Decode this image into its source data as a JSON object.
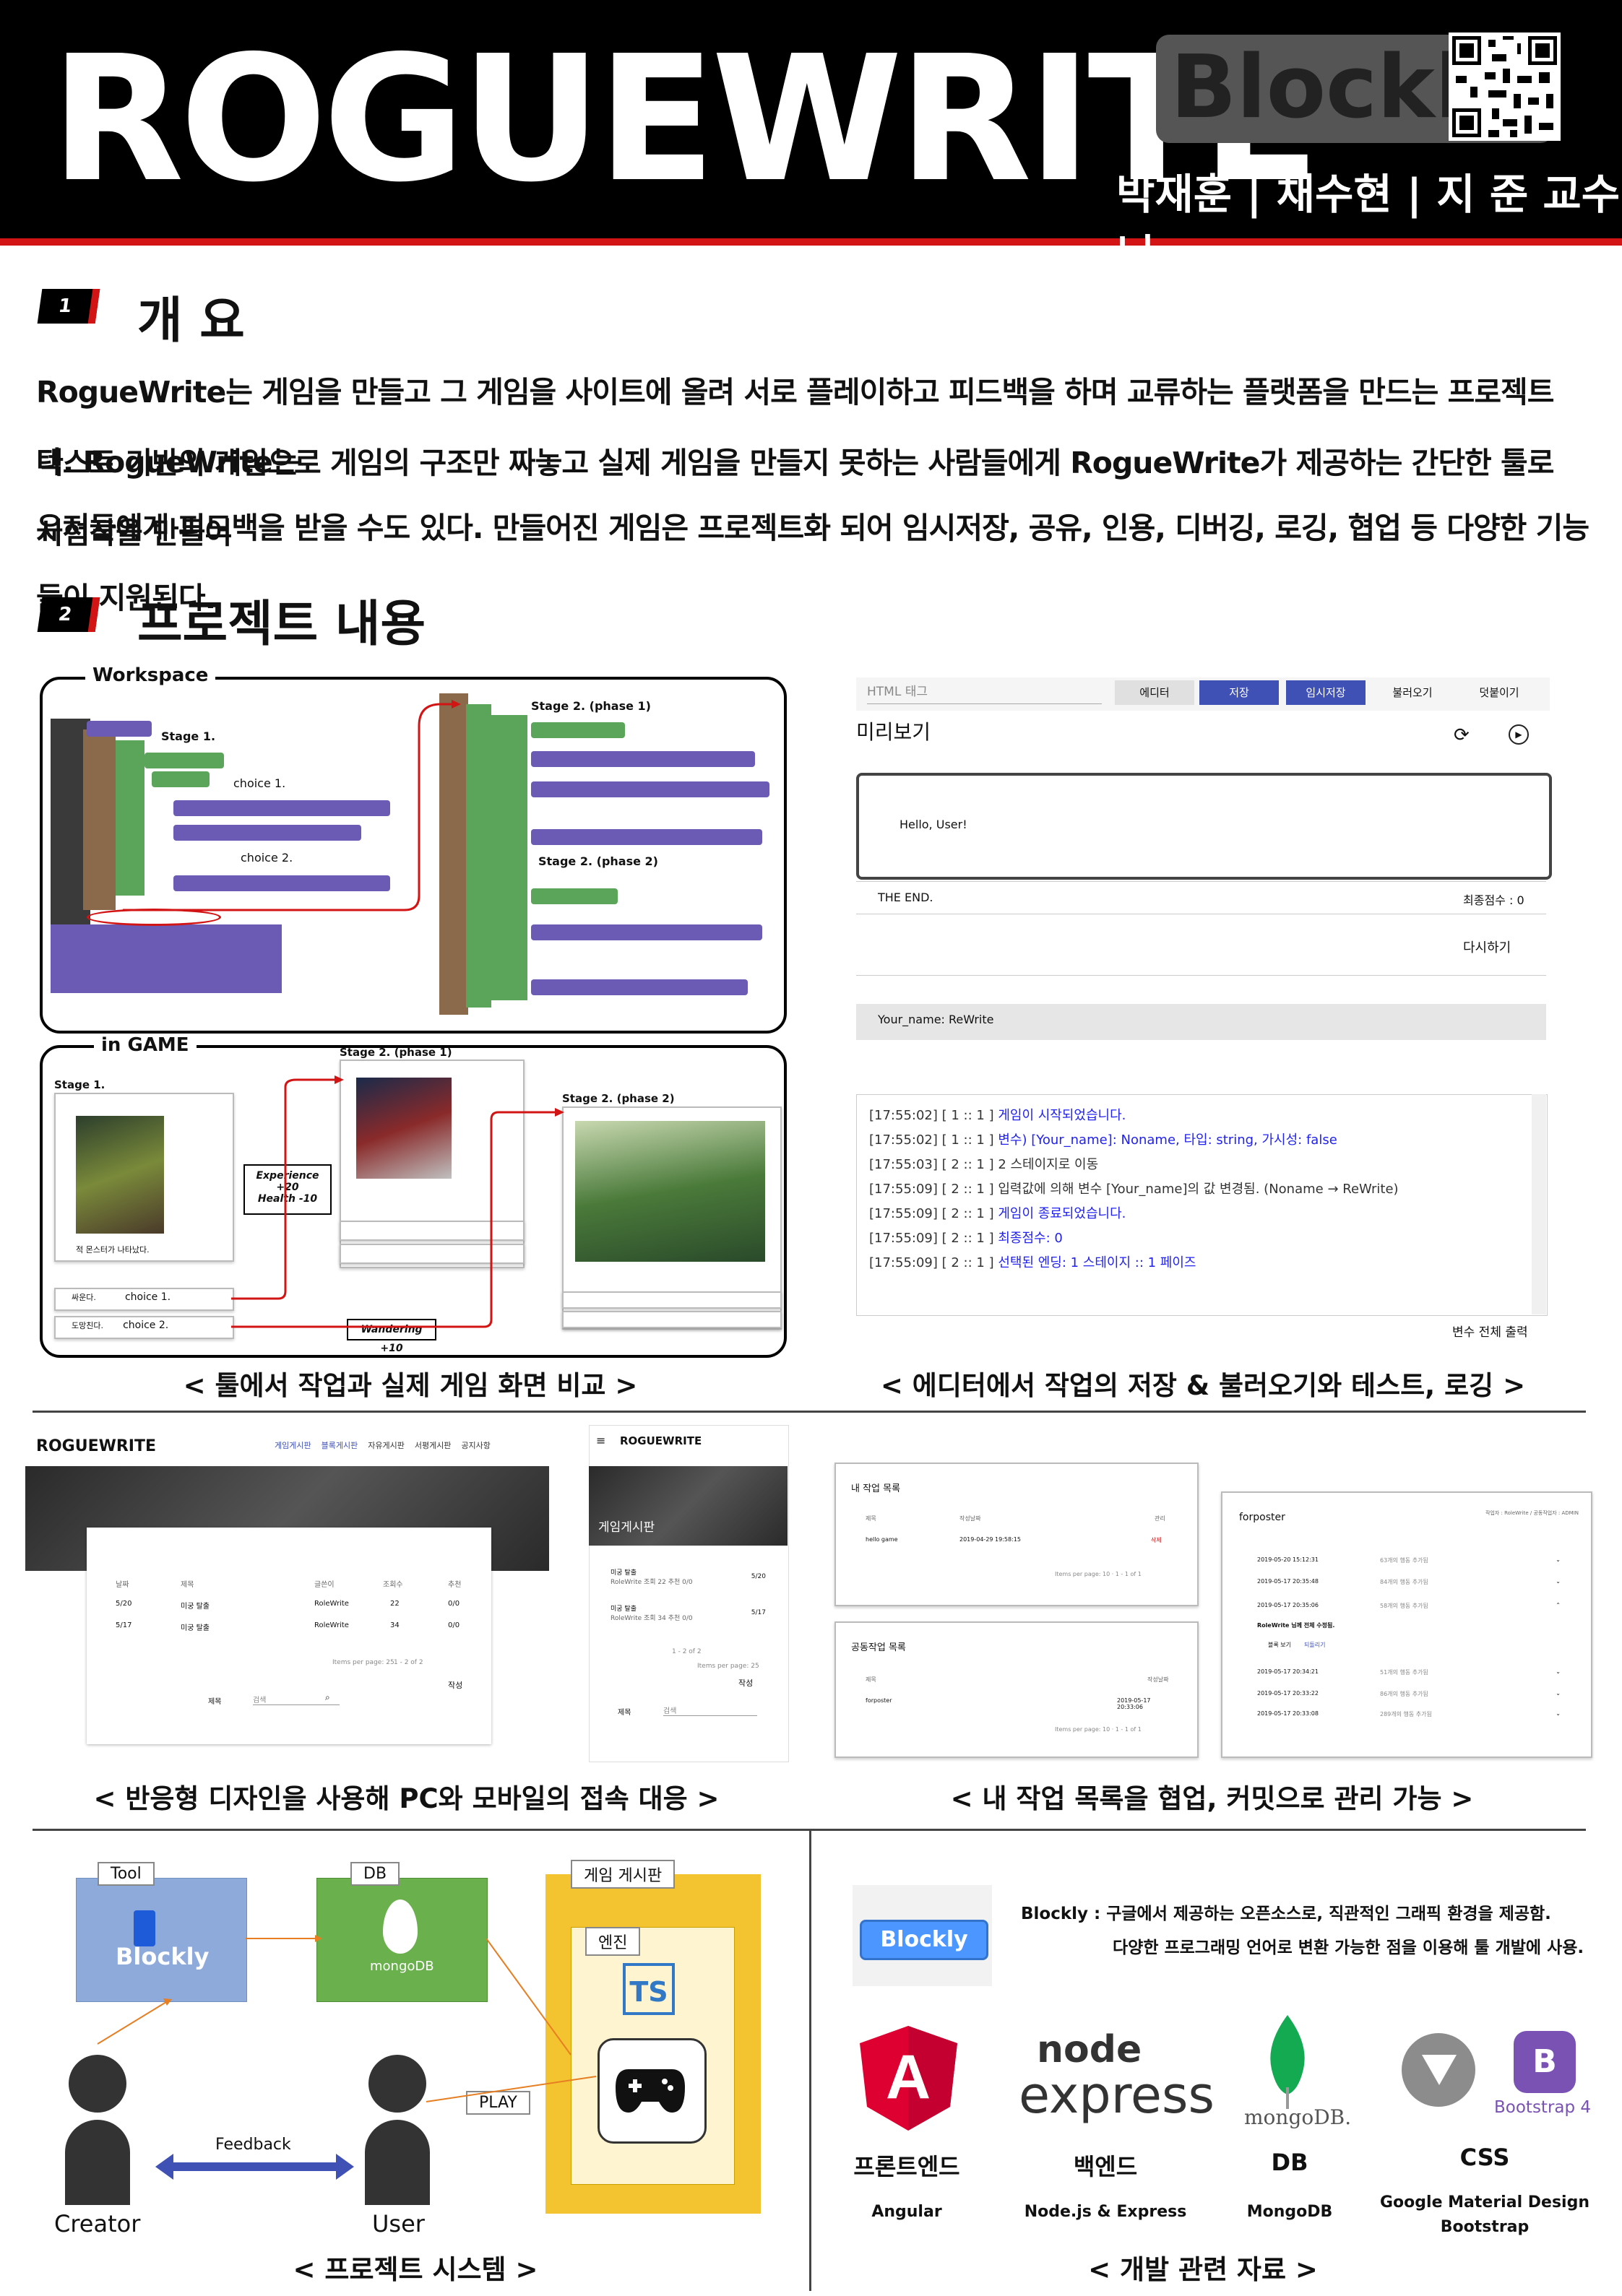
{
  "header": {
    "title": "ROGUEWRITE",
    "badge": "Blockly",
    "authors": "박재훈 | 채수현 | 지 준 교수님"
  },
  "sections": [
    {
      "number": "1",
      "title": "개 요"
    },
    {
      "number": "2",
      "title": "프로젝트 내용"
    }
  ],
  "overview": {
    "lines": [
      "RogueWrite는 게임을 만들고 그 게임을 사이트에 올려 서로 플레이하고 피드백을 하며 교류하는 플랫폼을 만드는 프로젝트다. RogueWrite는",
      "텍스트 기반의 게임으로 게임의 구조만 짜놓고 실제 게임을 만들지 못하는 사람들에게 RogueWrite가 제공하는 간단한 툴로 시험작을 만들어",
      "유저들에게 피드백을 받을 수도 있다. 만들어진 게임은 프로젝트화 되어 임시저장, 공유, 인용, 디버깅, 로깅, 협업 등 다양한 기능들이 지원된다."
    ]
  },
  "workspace": {
    "label": "Workspace",
    "stage1": "Stage 1.",
    "choice1": "choice 1.",
    "choice2": "choice 2.",
    "stage2p1": "Stage 2. (phase 1)",
    "stage2p2": "Stage 2. (phase 2)"
  },
  "ingame": {
    "label": "in GAME",
    "stage1": "Stage 1.",
    "stage2p1": "Stage 2. (phase 1)",
    "stage2p2": "Stage 2. (phase 2)",
    "stage1_text": "적 몬스터가 나타났다.",
    "choice1": "choice 1.",
    "choice2": "choice 2.",
    "choice1_pre": "싸운다.",
    "choice2_pre": "도망친다.",
    "effect1_a": "Experience +20",
    "effect1_b": "Health -10",
    "effect2": "Wandering +10"
  },
  "editor": {
    "html_tag_placeholder": "HTML 태그",
    "buttons": [
      "에디터",
      "저장",
      "임시저장",
      "불러오기",
      "덧붙이기"
    ],
    "preview_title": "미리보기",
    "hello": "Hello, User!",
    "the_end": "THE END.",
    "final_score": "최종점수 : 0",
    "retry": "다시하기",
    "your_name": "Your_name: ReWrite",
    "print_all": "변수 전체 출력",
    "log": [
      {
        "time": "[17:55:02]",
        "pos": "[ 1 :: 1 ]",
        "text": "게임이 시작되었습니다."
      },
      {
        "time": "[17:55:02]",
        "pos": "[ 1 :: 1 ]",
        "text": "변수) [Your_name]: Noname, 타입: string, 가시성: false"
      },
      {
        "time": "[17:55:03]",
        "pos": "[ 2 :: 1 ]",
        "text": "2 스테이지로 이동"
      },
      {
        "time": "[17:55:09]",
        "pos": "[ 2 :: 1 ]",
        "text": "입력값에 의해 변수 [Your_name]의 값 변경됨. (Noname → ReWrite)"
      },
      {
        "time": "[17:55:09]",
        "pos": "[ 2 :: 1 ]",
        "text": "게임이 종료되었습니다."
      },
      {
        "time": "[17:55:09]",
        "pos": "[ 2 :: 1 ]",
        "text": "최종점수: 0"
      },
      {
        "time": "[17:55:09]",
        "pos": "[ 2 :: 1 ]",
        "text": "선택된 엔딩: 1 스테이지 :: 1 페이즈"
      }
    ]
  },
  "captions": {
    "c1": "< 툴에서 작업과 실제 게임 화면 비교 >",
    "c2": "< 에디터에서 작업의 저장 & 불러오기와 테스트, 로깅 >",
    "c3": "< 반응형 디자인을 사용해 PC와 모바일의 접속 대응 >",
    "c4": "< 내 작업 목록을 협업, 커밋으로 관리 가능 >",
    "c5": "< 프로젝트 시스템 >",
    "c6": "< 개발 관련 자료 >"
  },
  "responsive": {
    "logo": "ROGUEWRITE",
    "nav": [
      "게임게시판",
      "블록게시판",
      "자유게시판",
      "서평게시판",
      "공지사항"
    ],
    "board_title": "게임게시판",
    "columns": [
      "날짜",
      "제목",
      "글쓴이",
      "조회수",
      "추천"
    ],
    "rows": [
      [
        "5/20",
        "미궁 탈출",
        "RoleWrite",
        "22",
        "0/0"
      ],
      [
        "5/17",
        "미궁 탈출",
        "RoleWrite",
        "34",
        "0/0"
      ]
    ],
    "mobile_rows": [
      {
        "title": "미궁 탈출",
        "meta": "RoleWrite 조회 22 추천 0/0",
        "date": "5/20"
      },
      {
        "title": "미궁 탈출",
        "meta": "RoleWrite 조회 34 추천 0/0",
        "date": "5/17"
      }
    ],
    "pager": "1 - 2 of 2",
    "items_per_page": "Items per page: 25",
    "write": "작성",
    "search_select": "제목",
    "search_placeholder": "검색"
  },
  "worklist": {
    "my_title": "내 작업 목록",
    "my_cols": [
      "제목",
      "작성날짜",
      "관리"
    ],
    "my_row": [
      "hello game",
      "2019-04-29 19:58:15",
      "삭제"
    ],
    "shared_title": "공동작업 목록",
    "shared_cols": [
      "제목",
      "작성날짜"
    ],
    "shared_row": [
      "forposter",
      "2019-05-17 20:33:06"
    ],
    "pager_text": "Items per page: 10 · 1 - 1 of 1",
    "commit_title": "forposter",
    "commit_meta": "작업자 : RoleWrite / 공동작업자 : ADMIN",
    "commits": [
      {
        "date": "2019-05-20 15:12:31",
        "note": "63개의 행동 추가됨"
      },
      {
        "date": "2019-05-17 20:35:48",
        "note": "84개의 행동 추가됨"
      },
      {
        "date": "2019-05-17 20:35:06",
        "note": "58개의 행동 추가됨"
      },
      {
        "date": "2019-05-17 20:34:21",
        "note": "51개의 행동 추가됨"
      },
      {
        "date": "2019-05-17 20:33:22",
        "note": "86개의 행동 추가됨"
      },
      {
        "date": "2019-05-17 20:33:08",
        "note": "289개의 행동 추가됨"
      }
    ],
    "commit_detail": "RoleWrite 님께 전체 수정됨.",
    "commit_actions": [
      "블록 보기",
      "되돌리기"
    ]
  },
  "system": {
    "tool": "Tool",
    "db": "DB",
    "board": "게임 게시판",
    "engine": "엔진",
    "blockly": "Blockly",
    "mongo": "mongoDB",
    "ts": "TS",
    "play": "PLAY",
    "feedback": "Feedback",
    "creator": "Creator",
    "user": "User"
  },
  "tech": {
    "blockly_badge": "Blockly",
    "blockly_desc_1": "Blockly : 구글에서 제공하는 오픈소스로, 직관적인 그래픽 환경을 제공함.",
    "blockly_desc_2": "다양한 프로그래밍 언어로 변환 가능한 점을 이용해 툴 개발에 사용.",
    "items": [
      {
        "logo": "A",
        "label": "프론트엔드",
        "sub": "Angular"
      },
      {
        "logo": "express",
        "label": "백엔드",
        "sub": "Node.js & Express"
      },
      {
        "logo": "mongoDB.",
        "label": "DB",
        "sub": "MongoDB"
      },
      {
        "logo": "Bootstrap 4",
        "label": "CSS",
        "sub": "Google Material Design\nBootstrap"
      }
    ],
    "node_logo": "node"
  },
  "colors": {
    "accent_red": "#d21414",
    "block_purple": "#6b5bb5",
    "block_green": "#5ba55b",
    "block_brown": "#8a6a4a",
    "db_green": "#6ab04c",
    "board_yellow": "#f4c430",
    "tool_blue": "#8eaadb",
    "angular_red": "#dd0031",
    "bootstrap_purple": "#7952b3"
  }
}
